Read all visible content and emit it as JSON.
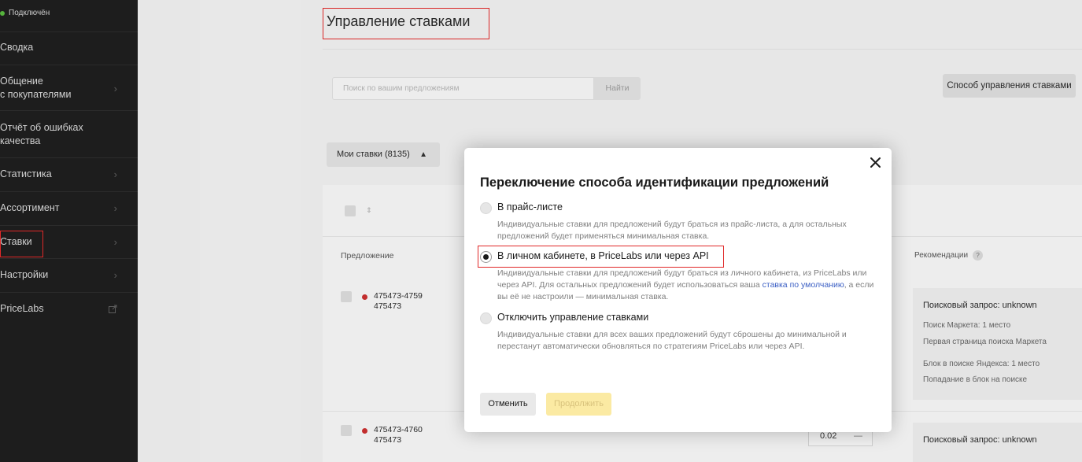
{
  "sidebar": {
    "status": "Подключён",
    "items": [
      {
        "label": "Сводка",
        "arrow": false
      },
      {
        "label": "Общение\nс покупателями",
        "arrow": true
      },
      {
        "label": "Отчёт об ошибках\nкачества",
        "arrow": false
      },
      {
        "label": "Статистика",
        "arrow": true
      },
      {
        "label": "Ассортимент",
        "arrow": true
      },
      {
        "label": "Ставки",
        "arrow": true
      },
      {
        "label": "Настройки",
        "arrow": true
      },
      {
        "label": "PriceLabs",
        "arrow": false,
        "external": true
      }
    ]
  },
  "page": {
    "title": "Управление ставками",
    "search_placeholder": "Поиск по вашим предложениям",
    "search_button": "Найти",
    "method_button": "Способ управления ставками",
    "my_bids_button": "Мои ставки (8135)",
    "col_offer": "Предложение",
    "col_recommendations": "Рекомендации",
    "rows": [
      {
        "id": "475473-4759",
        "sub": "475473"
      },
      {
        "id": "475473-4760",
        "sub": "475473",
        "bid": "0.02"
      }
    ],
    "rec1": {
      "title": "Поисковый запрос: unknown",
      "lines": [
        "Поиск Маркета: 1 место",
        "Первая страница поиска Маркета",
        "Блок в поиске Яндекса: 1 место",
        "Попадание в блок на поиске"
      ]
    },
    "rec2": {
      "title": "Поисковый запрос: unknown"
    }
  },
  "modal": {
    "title": "Переключение способа идентификации предложений",
    "options": [
      {
        "label": "В прайс-листе",
        "desc": "Индивидуальные ставки для предложений будут браться из прайс-листа, а для остальных предложений будет применяться минимальная ставка.",
        "checked": false
      },
      {
        "label": "В личном кабинете, в PriceLabs или через API",
        "desc_before": "Индивидуальные ставки для предложений будут браться из личного кабинета, из PriceLabs или через API. Для остальных предложений будет использоваться ваша",
        "desc_link": "ставка по умолчанию",
        "desc_after": ", а если вы её не настроили — минимальная ставка.",
        "checked": true
      },
      {
        "label": "Отключить управление ставками",
        "desc": "Индивидуальные ставки для всех ваших предложений будут сброшены до минимальной и перестанут автоматически обновляться по стратегиям PriceLabs или через API.",
        "checked": false
      }
    ],
    "cancel_button": "Отменить",
    "continue_button": "Продолжить"
  },
  "colors": {
    "sidebar_bg": "#1d1d1d",
    "status_green": "#55b33c",
    "highlight_red": "#e02828",
    "link_blue": "#3b5fc4",
    "primary_disabled": "#fbeaa3"
  }
}
